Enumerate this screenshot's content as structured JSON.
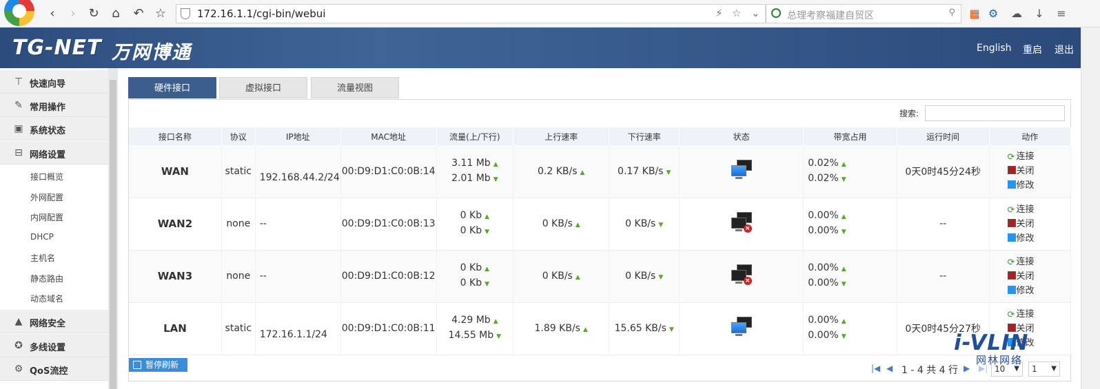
{
  "browser": {
    "url": "172.16.1.1/cgi-bin/webui",
    "search_placeholder": "总理考察福建自贸区"
  },
  "header": {
    "brand": "TG-NET",
    "brand_cn": "万网博通",
    "links": {
      "english": "English",
      "reboot": "重启",
      "logout": "退出"
    }
  },
  "sidebar": {
    "items": [
      {
        "label": "快速向导",
        "icon": "pin-icon"
      },
      {
        "label": "常用操作",
        "icon": "wrench-icon"
      },
      {
        "label": "系统状态",
        "icon": "monitor-icon"
      },
      {
        "label": "网络设置",
        "icon": "network-icon"
      },
      {
        "label": "网络安全",
        "icon": "warning-icon"
      },
      {
        "label": "多线设置",
        "icon": "multiline-icon"
      },
      {
        "label": "QoS流控",
        "icon": "qos-icon"
      }
    ],
    "sub_items": [
      "接口概览",
      "外网配置",
      "内网配置",
      "DHCP",
      "主机名",
      "静态路由",
      "动态域名"
    ]
  },
  "tabs": [
    {
      "label": "硬件接口",
      "active": true
    },
    {
      "label": "虚拟接口",
      "active": false
    },
    {
      "label": "流量视图",
      "active": false
    }
  ],
  "search": {
    "label": "搜索:"
  },
  "table": {
    "headers": [
      "接口名称",
      "协议",
      "IP地址",
      "MAC地址",
      "流量(上/下行)",
      "上行速率",
      "下行速率",
      "状态",
      "带宽占用",
      "运行时间",
      "动作"
    ],
    "actions": {
      "connect": "连接",
      "close": "关闭",
      "edit": "修改"
    },
    "rows": [
      {
        "name": "WAN",
        "protocol": "static",
        "ip": "192.168.44.2/24",
        "mac": "00:D9:D1:C0:0B:14",
        "traffic_up": "3.11 Mb",
        "traffic_down": "2.01 Mb",
        "up_rate": "0.2 KB/s",
        "down_rate": "0.17 KB/s",
        "status": "connected",
        "bw_up": "0.02%",
        "bw_down": "0.02%",
        "uptime": "0天0时45分24秒"
      },
      {
        "name": "WAN2",
        "protocol": "none",
        "ip": "--",
        "mac": "00:D9:D1:C0:0B:13",
        "traffic_up": "0 Kb",
        "traffic_down": "0 Kb",
        "up_rate": "0 KB/s",
        "down_rate": "0 KB/s",
        "status": "disconnected",
        "bw_up": "0.00%",
        "bw_down": "0.00%",
        "uptime": "--"
      },
      {
        "name": "WAN3",
        "protocol": "none",
        "ip": "--",
        "mac": "00:D9:D1:C0:0B:12",
        "traffic_up": "0 Kb",
        "traffic_down": "0 Kb",
        "up_rate": "0 KB/s",
        "down_rate": "0 KB/s",
        "status": "disconnected",
        "bw_up": "0.00%",
        "bw_down": "0.00%",
        "uptime": "--"
      },
      {
        "name": "LAN",
        "protocol": "static",
        "ip": "172.16.1.1/24",
        "mac": "00:D9:D1:C0:0B:11",
        "traffic_up": "4.29 Mb",
        "traffic_down": "14.55 Mb",
        "up_rate": "1.89 KB/s",
        "down_rate": "15.65 KB/s",
        "status": "connected",
        "bw_up": "0.00%",
        "bw_down": "0.00%",
        "uptime": "0天0时45分27秒"
      }
    ]
  },
  "footer": {
    "pause_label": "暂停刷新",
    "pager_text": "1 - 4 共 4 行",
    "page_size": "10",
    "page_num": "1"
  },
  "watermark": {
    "main": "i-VLIN",
    "sub": "网林网络"
  }
}
